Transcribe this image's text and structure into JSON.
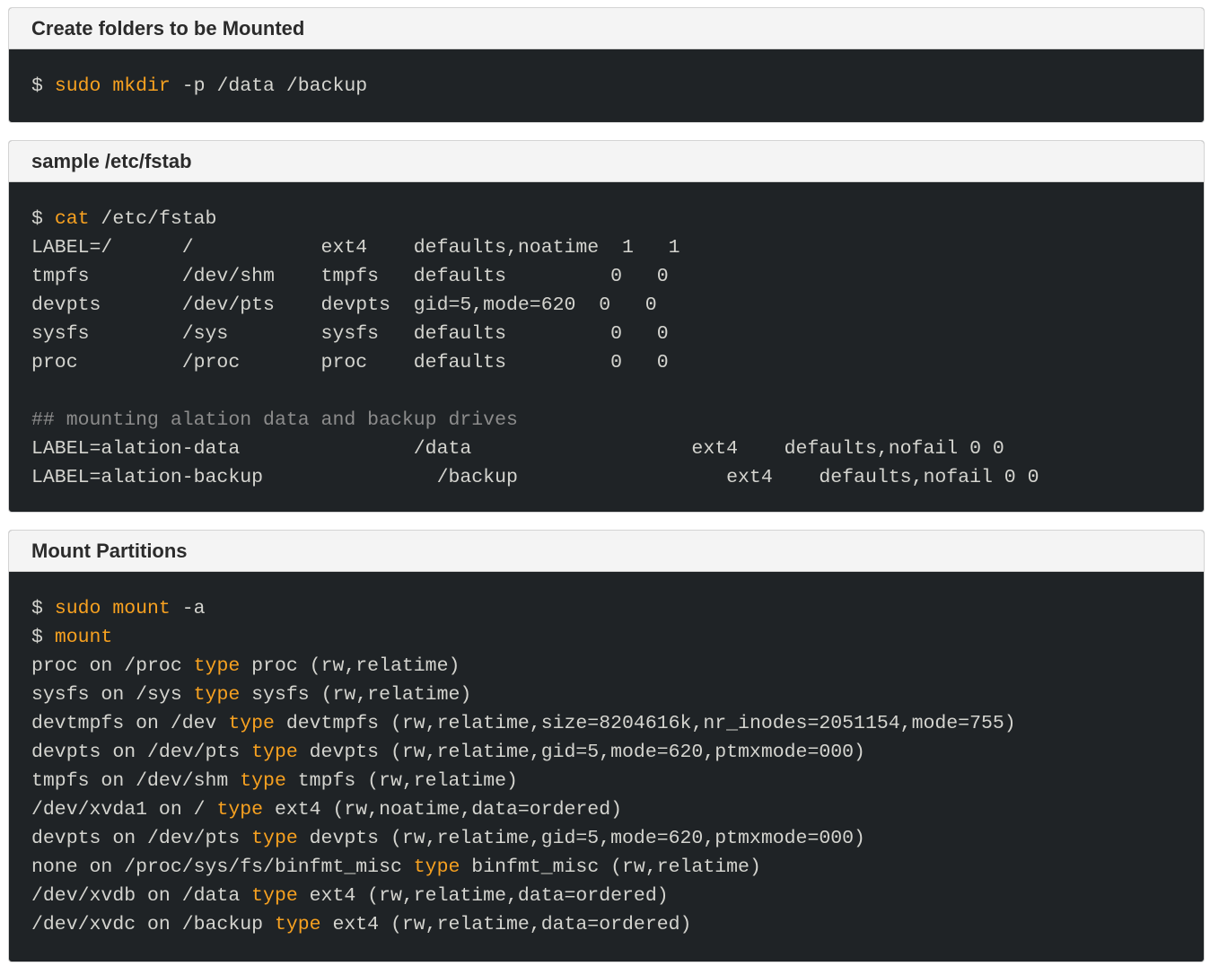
{
  "colors": {
    "header_bg": "#f4f4f4",
    "code_bg": "#1f2326",
    "code_text": "#d4d4cf",
    "keyword": "#f7a120",
    "comment": "#8c8c8c"
  },
  "panels": [
    {
      "title": "Create folders to be Mounted",
      "lines": [
        [
          {
            "t": "$ "
          },
          {
            "t": "sudo mkdir",
            "k": "kw"
          },
          {
            "t": " -p /data /backup"
          }
        ]
      ]
    },
    {
      "title": "sample /etc/fstab",
      "lines": [
        [
          {
            "t": "$ "
          },
          {
            "t": "cat",
            "k": "kw"
          },
          {
            "t": " /etc/fstab"
          }
        ],
        [
          {
            "t": "LABEL=/      /           ext4    defaults,noatime  1   1"
          }
        ],
        [
          {
            "t": "tmpfs        /dev/shm    tmpfs   defaults         0   0"
          }
        ],
        [
          {
            "t": "devpts       /dev/pts    devpts  gid=5,mode=620  0   0"
          }
        ],
        [
          {
            "t": "sysfs        /sys        sysfs   defaults         0   0"
          }
        ],
        [
          {
            "t": "proc         /proc       proc    defaults         0   0"
          }
        ],
        [
          {
            "t": ""
          }
        ],
        [
          {
            "t": "## mounting alation data and backup drives",
            "k": "cm"
          }
        ],
        [
          {
            "t": "LABEL=alation-data               /data                   ext4    defaults,nofail 0 0"
          }
        ],
        [
          {
            "t": "LABEL=alation-backup               /backup                  ext4    defaults,nofail 0 0"
          }
        ]
      ]
    },
    {
      "title": "Mount Partitions",
      "lines": [
        [
          {
            "t": "$ "
          },
          {
            "t": "sudo mount",
            "k": "kw"
          },
          {
            "t": " -a"
          }
        ],
        [
          {
            "t": "$ "
          },
          {
            "t": "mount",
            "k": "kw"
          }
        ],
        [
          {
            "t": "proc on /proc "
          },
          {
            "t": "type",
            "k": "kw"
          },
          {
            "t": " proc (rw,relatime)"
          }
        ],
        [
          {
            "t": "sysfs on /sys "
          },
          {
            "t": "type",
            "k": "kw"
          },
          {
            "t": " sysfs (rw,relatime)"
          }
        ],
        [
          {
            "t": "devtmpfs on /dev "
          },
          {
            "t": "type",
            "k": "kw"
          },
          {
            "t": " devtmpfs (rw,relatime,size=8204616k,nr_inodes=2051154,mode=755)"
          }
        ],
        [
          {
            "t": "devpts on /dev/pts "
          },
          {
            "t": "type",
            "k": "kw"
          },
          {
            "t": " devpts (rw,relatime,gid=5,mode=620,ptmxmode=000)"
          }
        ],
        [
          {
            "t": "tmpfs on /dev/shm "
          },
          {
            "t": "type",
            "k": "kw"
          },
          {
            "t": " tmpfs (rw,relatime)"
          }
        ],
        [
          {
            "t": "/dev/xvda1 on / "
          },
          {
            "t": "type",
            "k": "kw"
          },
          {
            "t": " ext4 (rw,noatime,data=ordered)"
          }
        ],
        [
          {
            "t": "devpts on /dev/pts "
          },
          {
            "t": "type",
            "k": "kw"
          },
          {
            "t": " devpts (rw,relatime,gid=5,mode=620,ptmxmode=000)"
          }
        ],
        [
          {
            "t": "none on /proc/sys/fs/binfmt_misc "
          },
          {
            "t": "type",
            "k": "kw"
          },
          {
            "t": " binfmt_misc (rw,relatime)"
          }
        ],
        [
          {
            "t": "/dev/xvdb on /data "
          },
          {
            "t": "type",
            "k": "kw"
          },
          {
            "t": " ext4 (rw,relatime,data=ordered)"
          }
        ],
        [
          {
            "t": "/dev/xvdc on /backup "
          },
          {
            "t": "type",
            "k": "kw"
          },
          {
            "t": " ext4 (rw,relatime,data=ordered)"
          }
        ]
      ]
    }
  ]
}
